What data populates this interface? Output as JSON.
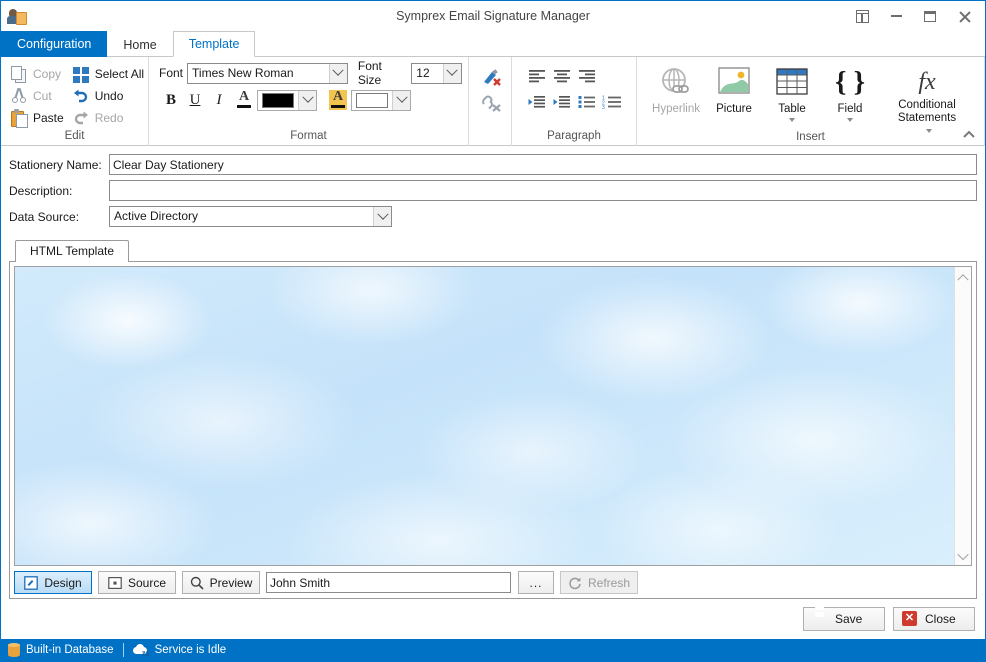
{
  "window": {
    "title": "Symprex Email Signature Manager",
    "app_icon": "user-card-icon",
    "controls": {
      "restore_up": "restore-up-icon",
      "minimize": "minimize-icon",
      "maximize": "maximize-icon",
      "close": "close-icon"
    },
    "accent_color": "#0072c6"
  },
  "ribbon": {
    "tabs": [
      {
        "label": "Configuration",
        "type": "file",
        "active": false
      },
      {
        "label": "Home",
        "type": "tab",
        "active": false
      },
      {
        "label": "Template",
        "type": "tab",
        "active": true
      }
    ],
    "collapse_icon": "chevron-up-icon",
    "groups": {
      "edit": {
        "title": "Edit",
        "items": [
          {
            "label": "Copy",
            "icon": "copy-icon",
            "enabled": false
          },
          {
            "label": "Cut",
            "icon": "cut-icon",
            "enabled": false
          },
          {
            "label": "Paste",
            "icon": "paste-icon",
            "enabled": true
          },
          {
            "label": "Select All",
            "icon": "select-all-icon",
            "enabled": true
          },
          {
            "label": "Undo",
            "icon": "undo-icon",
            "enabled": true
          },
          {
            "label": "Redo",
            "icon": "redo-icon",
            "enabled": false
          }
        ]
      },
      "format": {
        "title": "Format",
        "font_label": "Font",
        "font_value": "Times New Roman",
        "font_size_label": "Font Size",
        "font_size_value": "12",
        "bold_label": "B",
        "underline_label": "U",
        "italic_label": "I",
        "font_color_letter": "A",
        "highlight_letter": "A",
        "font_color_hex": "#000000",
        "highlight_color_hex": "#ffffff"
      },
      "tools": {
        "clear_formatting": "clear-formatting-icon",
        "remove_hyperlink": "remove-hyperlink-icon"
      },
      "paragraph": {
        "title": "Paragraph",
        "items": [
          "align-left-icon",
          "align-center-icon",
          "align-right-icon",
          "decrease-indent-icon",
          "increase-indent-icon",
          "bullet-list-icon",
          "numbered-list-icon"
        ]
      },
      "insert": {
        "title": "Insert",
        "items": [
          {
            "label": "Hyperlink",
            "icon": "hyperlink-icon",
            "enabled": false,
            "has_dropdown": false
          },
          {
            "label": "Picture",
            "icon": "picture-icon",
            "enabled": true,
            "has_dropdown": false
          },
          {
            "label": "Table",
            "icon": "table-icon",
            "enabled": true,
            "has_dropdown": true
          },
          {
            "label": "Field",
            "icon": "field-braces-icon",
            "enabled": true,
            "has_dropdown": true
          },
          {
            "label": "Conditional Statements",
            "icon": "function-fx-icon",
            "enabled": true,
            "has_dropdown": true
          }
        ]
      }
    }
  },
  "form": {
    "stationery_name_label": "Stationery Name:",
    "stationery_name_value": "Clear Day Stationery",
    "description_label": "Description:",
    "description_value": "",
    "data_source_label": "Data Source:",
    "data_source_value": "Active Directory"
  },
  "tabpanel": {
    "tab_label": "HTML Template",
    "editor": {
      "background": "clear-day-sky-stationery",
      "content": "",
      "scrollbar": {
        "up": "chevron-up-icon",
        "down": "chevron-down-icon"
      }
    }
  },
  "editor_toolbar": {
    "design_label": "Design",
    "design_icon": "design-view-icon",
    "source_label": "Source",
    "source_icon": "source-view-icon",
    "preview_label": "Preview",
    "preview_icon": "magnifier-icon",
    "preview_user_value": "John Smith",
    "browse_label": "...",
    "refresh_label": "Refresh",
    "refresh_icon": "refresh-icon",
    "active_view": "Design"
  },
  "actions": {
    "save_label": "Save",
    "save_icon": "floppy-save-icon",
    "close_label": "Close",
    "close_icon": "red-x-icon"
  },
  "statusbar": {
    "database_label": "Built-in Database",
    "database_icon": "database-icon",
    "service_label": "Service is Idle",
    "service_icon": "cloud-sleep-icon"
  }
}
